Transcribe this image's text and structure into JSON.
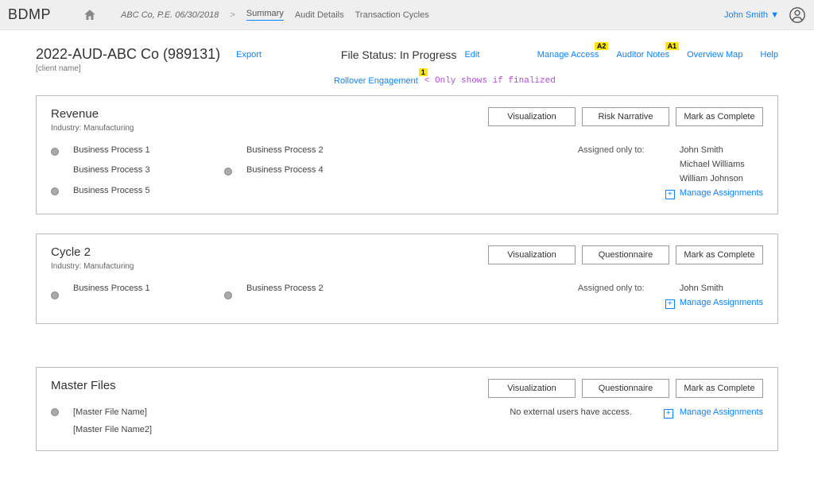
{
  "topbar": {
    "brand": "BDMP",
    "crumbs": {
      "context": "ABC Co, P.E. 06/30/2018",
      "summary": "Summary",
      "audit_details": "Audit Details",
      "transaction_cycles": "Transaction Cycles"
    },
    "user": "John Smith ▼"
  },
  "header": {
    "title": "2022-AUD-ABC Co (989131)",
    "export": "Export",
    "file_status": "File Status: In Progress",
    "edit": "Edit",
    "client_name": "[client name]",
    "manage_access": "Manage Access",
    "manage_access_badge": "A2",
    "auditor_notes": "Auditor Notes",
    "auditor_notes_badge": "A1",
    "overview_map": "Overview Map",
    "help": "Help",
    "rollover": "Rollover Engagement",
    "rollover_badge": "1",
    "rollover_note": "< Only shows if finalized"
  },
  "cards": [
    {
      "title": "Revenue",
      "industry": "Industry: Manufacturing",
      "buttons": [
        "Visualization",
        "Risk Narrative",
        "Mark as Complete"
      ],
      "bp": [
        {
          "dot": true,
          "name": "Business Process 1"
        },
        {
          "dot": false,
          "name": "Business Process 2"
        },
        {
          "dot": false,
          "name": "Business Process 3"
        },
        {
          "dot": true,
          "name": "Business Process 4"
        },
        {
          "dot": true,
          "name": "Business Process 5"
        }
      ],
      "assigned_label": "Assigned only to:",
      "assigned": [
        "John Smith",
        "Michael Williams",
        "William Johnson"
      ],
      "manage": "Manage Assignments"
    },
    {
      "title": "Cycle 2",
      "industry": "Industry: Manufacturing",
      "buttons": [
        "Visualization",
        "Questionnaire",
        "Mark as Complete"
      ],
      "bp": [
        {
          "dot": true,
          "name": "Business Process 1"
        },
        {
          "dot": true,
          "name": "Business Process 2"
        }
      ],
      "assigned_label": "Assigned only to:",
      "assigned": [
        "John Smith"
      ],
      "manage": "Manage Assignments"
    }
  ],
  "master": {
    "title": "Master Files",
    "buttons": [
      "Visualization",
      "Questionnaire",
      "Mark as Complete"
    ],
    "files": [
      {
        "dot": true,
        "name": "[Master File Name]"
      },
      {
        "dot": false,
        "name": "[Master File Name2]"
      }
    ],
    "no_access": "No external users have access.",
    "manage": "Manage Assignments"
  }
}
